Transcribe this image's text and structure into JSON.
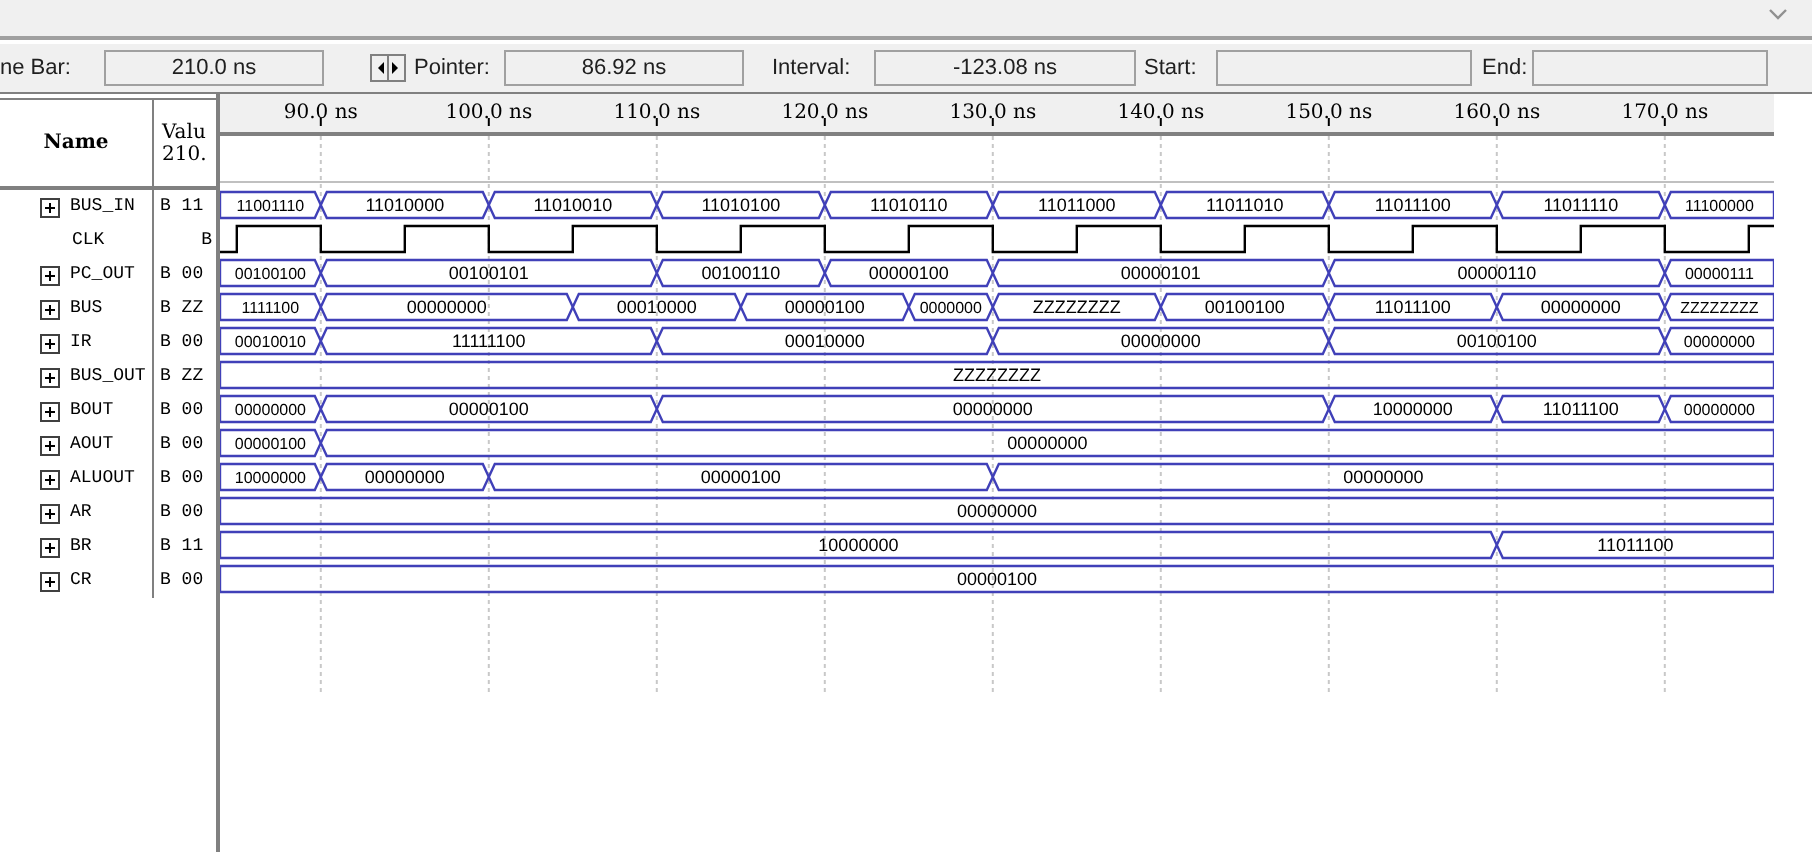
{
  "time_bar": {
    "label": "ne Bar:",
    "value": "210.0 ns"
  },
  "pointer": {
    "label": "Pointer:",
    "value": "86.92 ns"
  },
  "interval": {
    "label": "Interval:",
    "value": "-123.08 ns"
  },
  "start": {
    "label": "Start:"
  },
  "end": {
    "label": "End:"
  },
  "columns": {
    "name": "Name",
    "value_line_1": "Valu",
    "value_line_2": "210."
  },
  "ruler": [
    "90.0 ns",
    "100.0 ns",
    "110.0 ns",
    "120.0 ns",
    "130.0 ns",
    "140.0 ns",
    "150.0 ns",
    "160.0 ns",
    "170.0 ns"
  ],
  "signals": [
    {
      "name": "BUS_IN",
      "value": "B 11",
      "kind": "bus",
      "segments": [
        "11001110",
        "11010000",
        "11010010",
        "11010100",
        "11010110",
        "11011000",
        "11011010",
        "11011100",
        "11011110",
        "11100000"
      ]
    },
    {
      "name": "CLK",
      "value": "B",
      "kind": "clock"
    },
    {
      "name": "PC_OUT",
      "value": "B 00",
      "kind": "bus",
      "segments": [
        "00100100",
        "00100101",
        "00100110",
        "00000100",
        "00000101",
        "00000110",
        "00000111"
      ]
    },
    {
      "name": "BUS",
      "value": "B ZZ",
      "kind": "bus",
      "segments": [
        "1111100",
        "00000000",
        "00010000",
        "00000100",
        "0000000",
        "ZZZZZZZZ",
        "00100100",
        "11011100",
        "00000000",
        "ZZZZZZZZ"
      ]
    },
    {
      "name": "IR",
      "value": "B 00",
      "kind": "bus",
      "segments": [
        "00010010",
        "11111100",
        "00010000",
        "00000000",
        "00100100",
        "00000000"
      ]
    },
    {
      "name": "BUS_OUT",
      "value": "B ZZ",
      "kind": "bus",
      "segments": [
        "ZZZZZZZZ"
      ]
    },
    {
      "name": "BOUT",
      "value": "B 00",
      "kind": "bus",
      "segments": [
        "00000000",
        "00000100",
        "00000000",
        "10000000",
        "11011100",
        "00000000"
      ]
    },
    {
      "name": "AOUT",
      "value": "B 00",
      "kind": "bus",
      "segments": [
        "00000100",
        "00000000"
      ]
    },
    {
      "name": "ALUOUT",
      "value": "B 00",
      "kind": "bus",
      "segments": [
        "10000000",
        "00000000",
        "00000100",
        "00000000"
      ]
    },
    {
      "name": "AR",
      "value": "B 00",
      "kind": "bus",
      "segments": [
        "00000000"
      ]
    },
    {
      "name": "BR",
      "value": "B 11",
      "kind": "bus",
      "segments": [
        "10000000",
        "11011100"
      ]
    },
    {
      "name": "CR",
      "value": "B 00",
      "kind": "bus",
      "segments": [
        "00000100"
      ]
    }
  ]
}
